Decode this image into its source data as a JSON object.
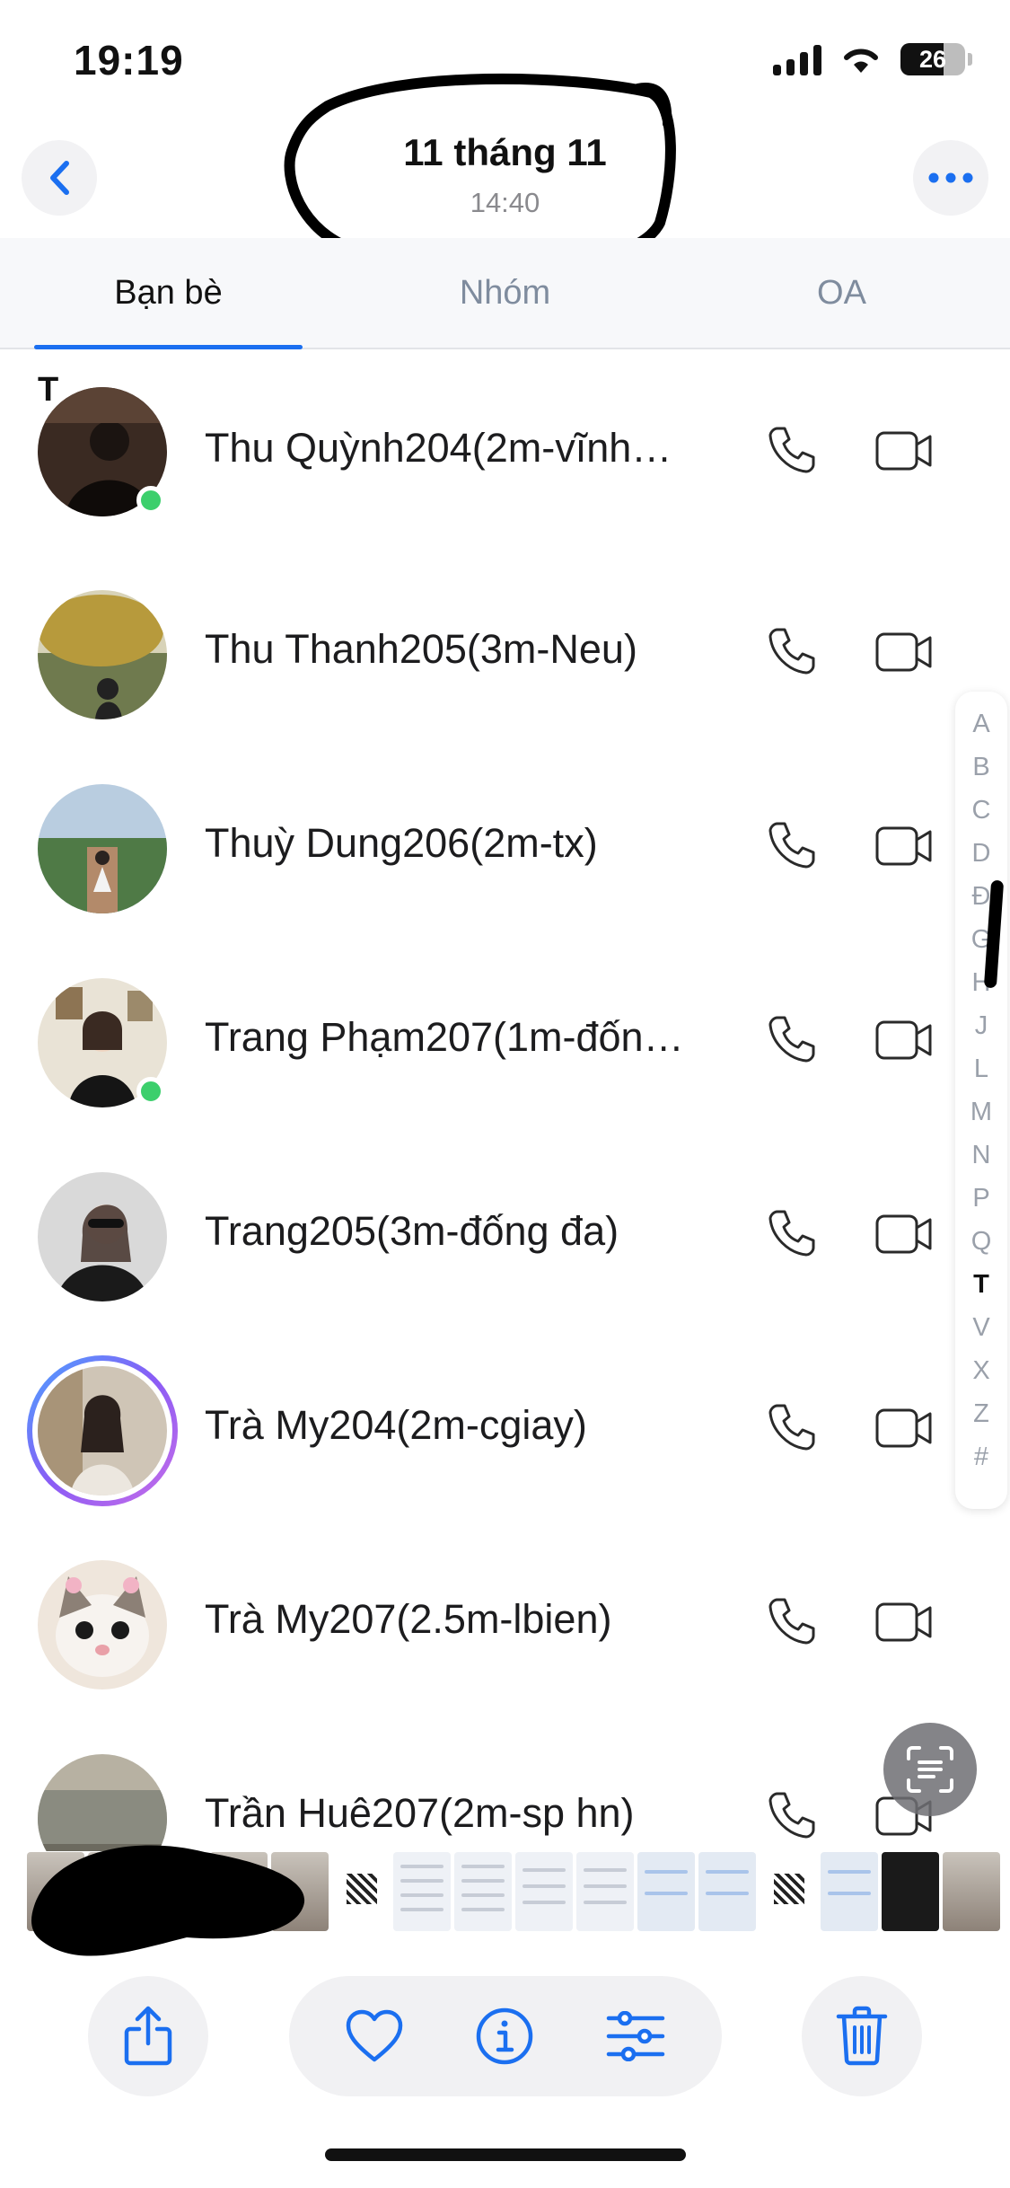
{
  "status_bar": {
    "time": "19:19",
    "battery": "26"
  },
  "header": {
    "title": "11 tháng 11",
    "subtitle": "14:40"
  },
  "tabs": [
    {
      "label": "Bạn bè",
      "active": true
    },
    {
      "label": "Nhóm",
      "active": false
    },
    {
      "label": "OA",
      "active": false
    }
  ],
  "section_letter": "T",
  "contacts": [
    {
      "name": "Thu Quỳnh204(2m-vĩnh…",
      "online": true
    },
    {
      "name": "Thu Thanh205(3m-Neu)",
      "online": false
    },
    {
      "name": "Thuỳ Dung206(2m-tx)",
      "online": false
    },
    {
      "name": "Trang Phạm207(1m-đốn…",
      "online": true
    },
    {
      "name": "Trang205(3m-đống đa)",
      "online": false
    },
    {
      "name": "Trà My204(2m-cgiay)",
      "online": false,
      "story": true
    },
    {
      "name": "Trà My207(2.5m-lbien)",
      "online": false
    },
    {
      "name": "Trần Huê207(2m-sp hn)",
      "online": false
    }
  ],
  "alphabet": [
    "A",
    "B",
    "C",
    "D",
    "Đ",
    "G",
    "H",
    "J",
    "L",
    "M",
    "N",
    "P",
    "Q",
    "T",
    "V",
    "X",
    "Z",
    "#"
  ],
  "alphabet_current": "T",
  "colors": {
    "accent": "#1b6ff0",
    "online": "#3ccf6c",
    "tab_inactive": "#7f8c9e"
  },
  "toolbar_icons": [
    "share-icon",
    "heart-icon",
    "info-icon",
    "adjust-icon",
    "trash-icon"
  ]
}
